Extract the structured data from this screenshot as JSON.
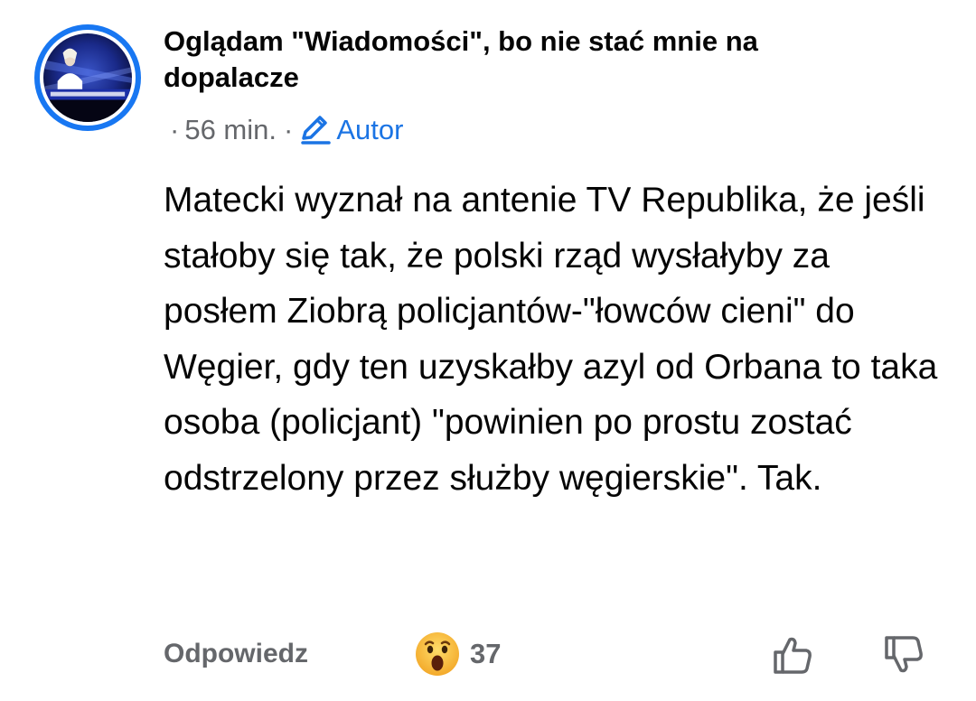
{
  "post": {
    "group_name": "Oglądam \"Wiadomości\", bo nie stać mnie na dopalacze",
    "separator": "·",
    "time": "56 min.",
    "author_label": "Autor",
    "body": "Matecki wyznał na antenie TV Republika, że jeśli stałoby się tak, że polski rząd wysłałyby za posłem Ziobrą policjantów-\"łowców cieni\" do Węgier, gdy ten uzyskałby azyl od Orbana to taka osoba (policjant) \"powinien po prostu zostać odstrzelony przez służby węgierskie\". Tak."
  },
  "footer": {
    "reply_label": "Odpowiedz",
    "reaction_icon": "wow-emoji-icon",
    "reaction_count": "37",
    "like_icon": "thumbs-up-icon",
    "dislike_icon": "thumbs-down-icon"
  },
  "colors": {
    "accent": "#1877f2",
    "author_blue": "#1b74e4",
    "muted_text": "#65676b",
    "text": "#050505"
  }
}
